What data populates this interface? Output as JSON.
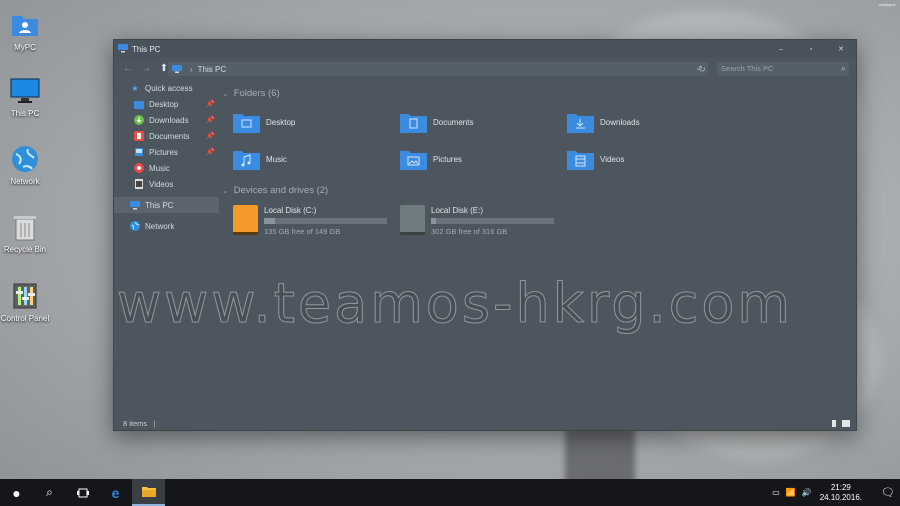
{
  "desktop": {
    "icons": [
      {
        "label": "MyPC",
        "icon": "user-folder-icon"
      },
      {
        "label": "This PC",
        "icon": "monitor-icon"
      },
      {
        "label": "Network",
        "icon": "globe-icon"
      },
      {
        "label": "Recycle Bin",
        "icon": "trash-icon"
      },
      {
        "label": "Control Panel",
        "icon": "control-panel-icon"
      }
    ],
    "watermark": "www.teamos-hkrg.com"
  },
  "window": {
    "title": "This PC",
    "controls": {
      "minimize": "–",
      "maximize": "▫",
      "close": "✕"
    },
    "address": {
      "crumb1": "This PC",
      "separator": "›"
    },
    "search_placeholder": "Search This PC",
    "nav": {
      "quick_access": "Quick access",
      "items": [
        "Desktop",
        "Downloads",
        "Documents",
        "Pictures",
        "Music",
        "Videos"
      ],
      "this_pc": "This PC",
      "network": "Network"
    },
    "folders_header": "Folders (6)",
    "folders": [
      "Desktop",
      "Documents",
      "Downloads",
      "Music",
      "Pictures",
      "Videos"
    ],
    "drives_header": "Devices and drives (2)",
    "drives": [
      {
        "name": "Local Disk (C:)",
        "free": "135 GB free of 149 GB",
        "used_fraction": 0.09,
        "color": "#f59a2a"
      },
      {
        "name": "Local Disk (E:)",
        "free": "302 GB free of 316 GB",
        "used_fraction": 0.04,
        "color": "#6f7b7e"
      }
    ],
    "status": "8 items"
  },
  "taskbar": {
    "time": "21:29",
    "date": "24.10.2016."
  },
  "colors": {
    "accent": "#3b8be0",
    "window_bg": "#4d565f",
    "taskbar_bg": "#141619"
  }
}
